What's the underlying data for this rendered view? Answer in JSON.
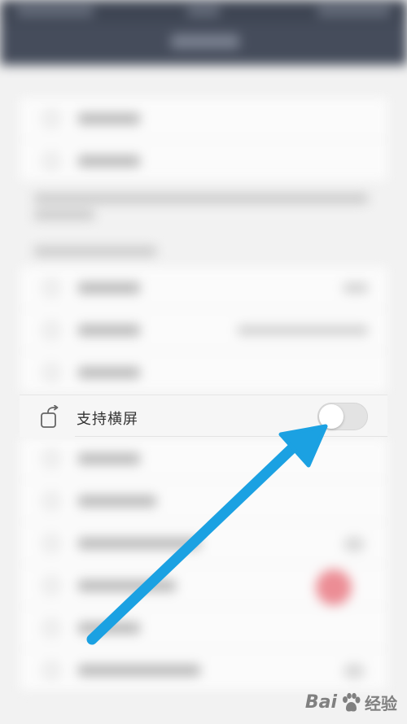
{
  "settings": {
    "rotation_row": {
      "label": "支持横屏",
      "icon": "screen-rotation-icon",
      "toggle_on": false
    }
  },
  "watermark": {
    "latin": "Bai",
    "chinese": "经验"
  },
  "colors": {
    "annotation_arrow": "#1ba1e2",
    "toggle_off_track": "#e3e3e3",
    "nav_bar": "#454c5b"
  }
}
